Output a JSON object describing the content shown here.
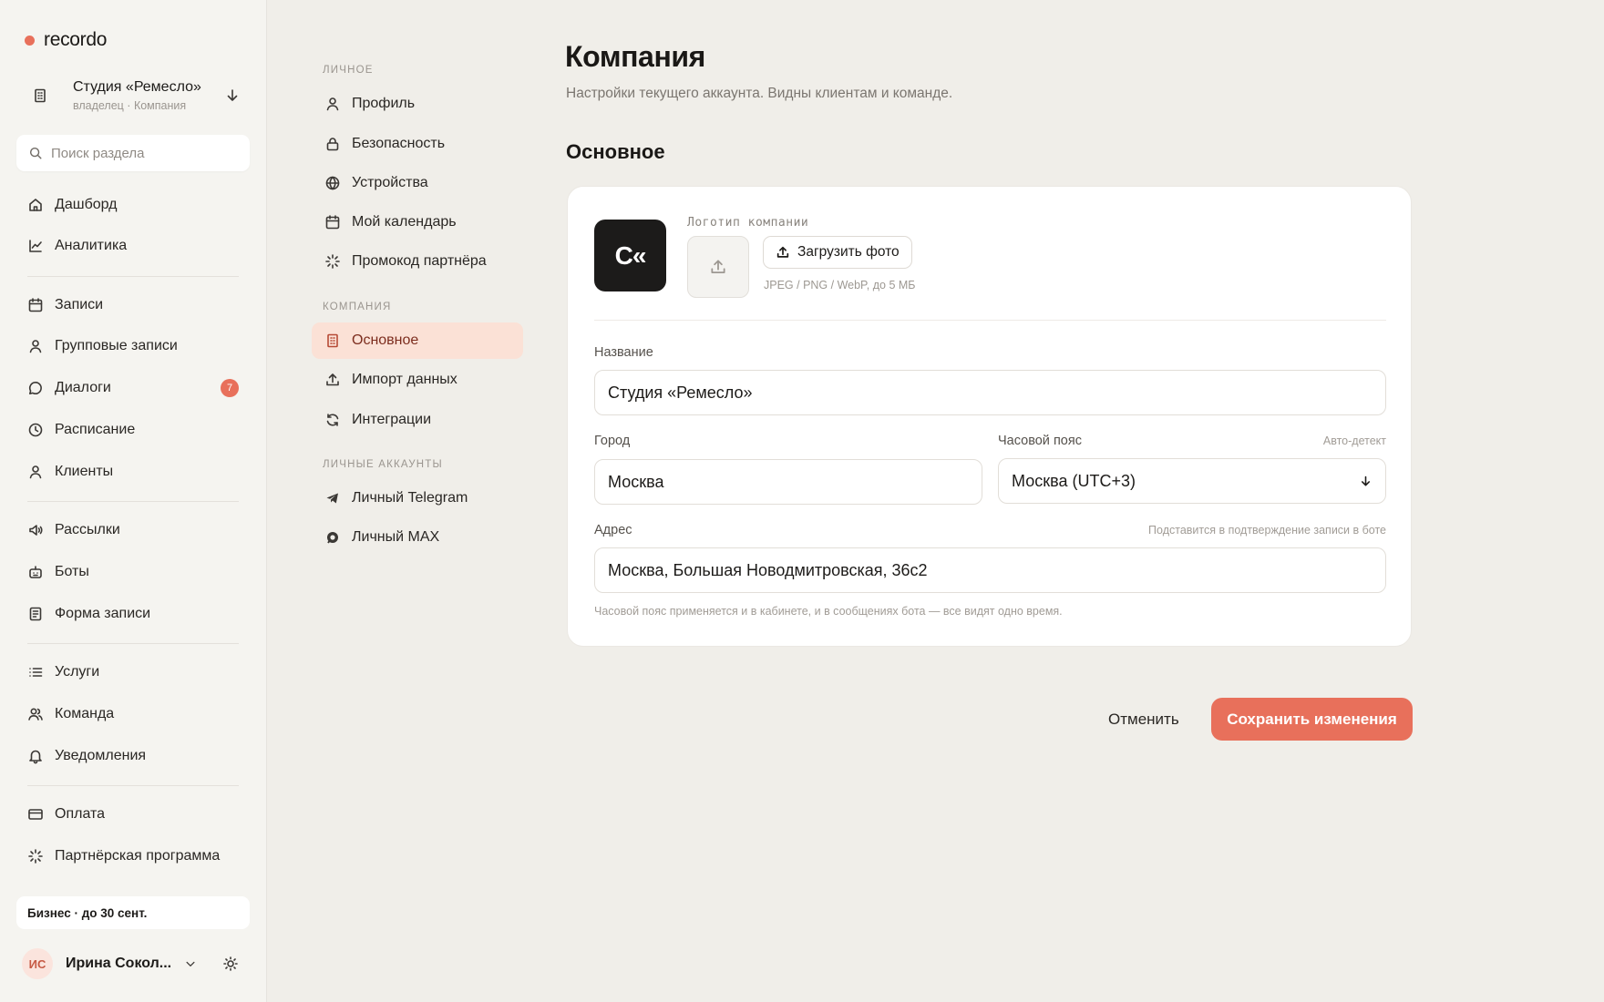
{
  "brand": {
    "name": "recordo",
    "accent": "#e8705b"
  },
  "workspace": {
    "name": "Студия «Ремесло»",
    "role": "владелец · Компания",
    "icon": "building-icon",
    "toggle_icon": "arrow-down-icon"
  },
  "search": {
    "placeholder": "Поиск раздела",
    "value": ""
  },
  "sidebar": {
    "items": [
      {
        "label": "Дашборд",
        "icon": "home-icon"
      },
      {
        "label": "Аналитика",
        "icon": "chart-icon"
      },
      {
        "label": "Записи",
        "icon": "calendar-icon"
      },
      {
        "label": "Групповые записи",
        "icon": "user-icon"
      },
      {
        "label": "Диалоги",
        "icon": "chat-icon",
        "badge": "7"
      },
      {
        "label": "Расписание",
        "icon": "clock-icon"
      },
      {
        "label": "Клиенты",
        "icon": "user-icon"
      },
      {
        "label": "Рассылки",
        "icon": "megaphone-icon"
      },
      {
        "label": "Боты",
        "icon": "bot-icon"
      },
      {
        "label": "Форма записи",
        "icon": "form-icon"
      },
      {
        "label": "Услуги",
        "icon": "list-icon"
      },
      {
        "label": "Команда",
        "icon": "team-icon"
      },
      {
        "label": "Уведомления",
        "icon": "bell-icon"
      },
      {
        "label": "Оплата",
        "icon": "card-icon"
      },
      {
        "label": "Партнёрская программа",
        "icon": "spark-icon"
      }
    ]
  },
  "plan": {
    "label": "Бизнес · до 30 сент."
  },
  "user": {
    "initials": "ИС",
    "name": "Ирина Сокол..."
  },
  "settings_nav": {
    "sections": [
      {
        "title": "Личное",
        "items": [
          {
            "label": "Профиль",
            "icon": "user-icon"
          },
          {
            "label": "Безопасность",
            "icon": "lock-icon"
          },
          {
            "label": "Устройства",
            "icon": "globe-icon"
          },
          {
            "label": "Мой календарь",
            "icon": "calendar-icon"
          },
          {
            "label": "Промокод партнёра",
            "icon": "spark-icon"
          }
        ]
      },
      {
        "title": "Компания",
        "items": [
          {
            "label": "Основное",
            "icon": "building-icon",
            "active": true
          },
          {
            "label": "Импорт данных",
            "icon": "upload-icon"
          },
          {
            "label": "Интеграции",
            "icon": "refresh-icon"
          }
        ]
      },
      {
        "title": "Личные аккаунты",
        "items": [
          {
            "label": "Личный Telegram",
            "icon": "telegram-icon"
          },
          {
            "label": "Личный MAX",
            "icon": "max-icon"
          }
        ]
      }
    ]
  },
  "page": {
    "title": "Компания",
    "subtitle": "Настройки текущего аккаунта. Видны клиентам и команде.",
    "section": "Основное"
  },
  "logo": {
    "tile_text": "C«",
    "label": "Логотип компании",
    "upload_label": "Загрузить фото",
    "hint": "JPEG / PNG / WebP, до 5 МБ"
  },
  "form": {
    "name": {
      "label": "Название",
      "value": "Студия «Ремесло»"
    },
    "city": {
      "label": "Город",
      "value": "Москва"
    },
    "timezone": {
      "label": "Часовой пояс",
      "hint": "Авто-детект",
      "value": "Москва (UTC+3)"
    },
    "address": {
      "label": "Адрес",
      "hint": "Подставится в подтверждение записи в боте",
      "value": "Москва, Большая Новодмитровская, 36с2"
    },
    "footnote": "Часовой пояс применяется и в кабинете, и в сообщениях бота — все видят одно время."
  },
  "actions": {
    "cancel": "Отменить",
    "save": "Сохранить изменения"
  }
}
